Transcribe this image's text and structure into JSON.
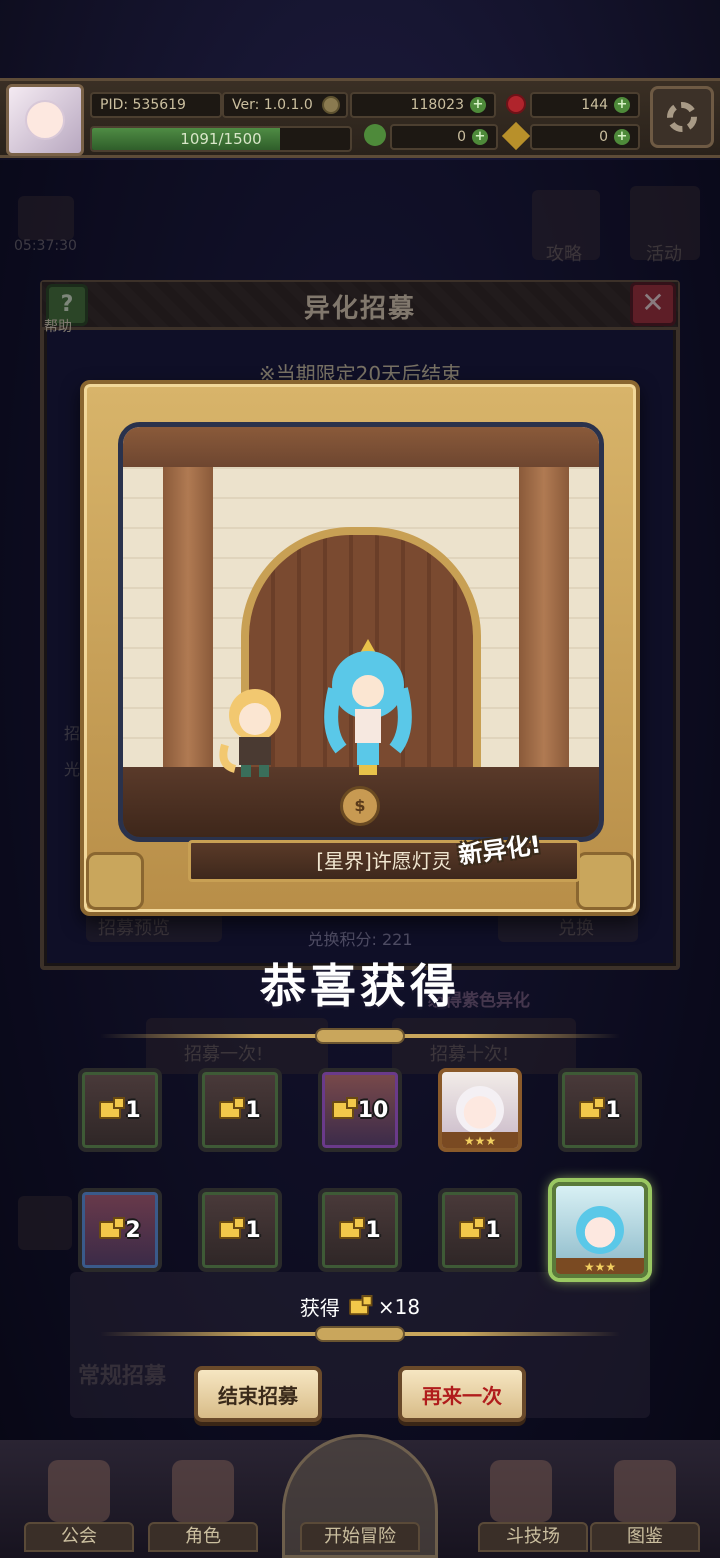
{
  "header": {
    "pid": "PID: 535619",
    "version": "Ver: 1.0.1.0",
    "gold": "118023",
    "gems": "144",
    "xp": "1091/1500",
    "xp_fraction": 0.727,
    "clover": "0",
    "key": "0"
  },
  "background": {
    "timer": "05:37:30",
    "guide_label": "攻略",
    "event_label": "活动",
    "side_label_1": "招",
    "side_label_2": "光",
    "preview_label": "招募预览",
    "exchange_label": "兑换",
    "purple_label": "必得紫色异化",
    "once_label": "招募一次!",
    "ten_label": "招募十次!",
    "regular_label": "常规招募"
  },
  "panel": {
    "title": "异化招募",
    "help_label": "帮助",
    "limited_text": "※当期限定20天后结束",
    "exchange_points": "兑换积分: 221"
  },
  "result": {
    "character_name": "[星界]许愿灯灵",
    "new_badge": "新异化!",
    "congrats": "恭喜获得"
  },
  "items": {
    "row1": [
      {
        "type": "shard",
        "count": "1"
      },
      {
        "type": "shard",
        "count": "1"
      },
      {
        "type": "shard",
        "count": "10"
      },
      {
        "type": "character",
        "stars": "★★★"
      },
      {
        "type": "shard",
        "count": "1"
      }
    ],
    "row2": [
      {
        "type": "shard",
        "count": "2"
      },
      {
        "type": "shard",
        "count": "1"
      },
      {
        "type": "shard",
        "count": "1"
      },
      {
        "type": "shard",
        "count": "1"
      },
      {
        "type": "character",
        "stars": "★★★"
      }
    ]
  },
  "summary": {
    "obtain_label": "获得",
    "obtain_count": "×18"
  },
  "buttons": {
    "end_label": "结束招募",
    "again_label": "再来一次"
  },
  "nav": {
    "guild": "公会",
    "character": "角色",
    "adventure": "开始冒险",
    "arena": "斗技场",
    "codex": "图鉴"
  },
  "colors": {
    "gold_frame": "#c9a65c",
    "again_text": "#b01c1c",
    "highlight_glow": "#9ac862"
  }
}
